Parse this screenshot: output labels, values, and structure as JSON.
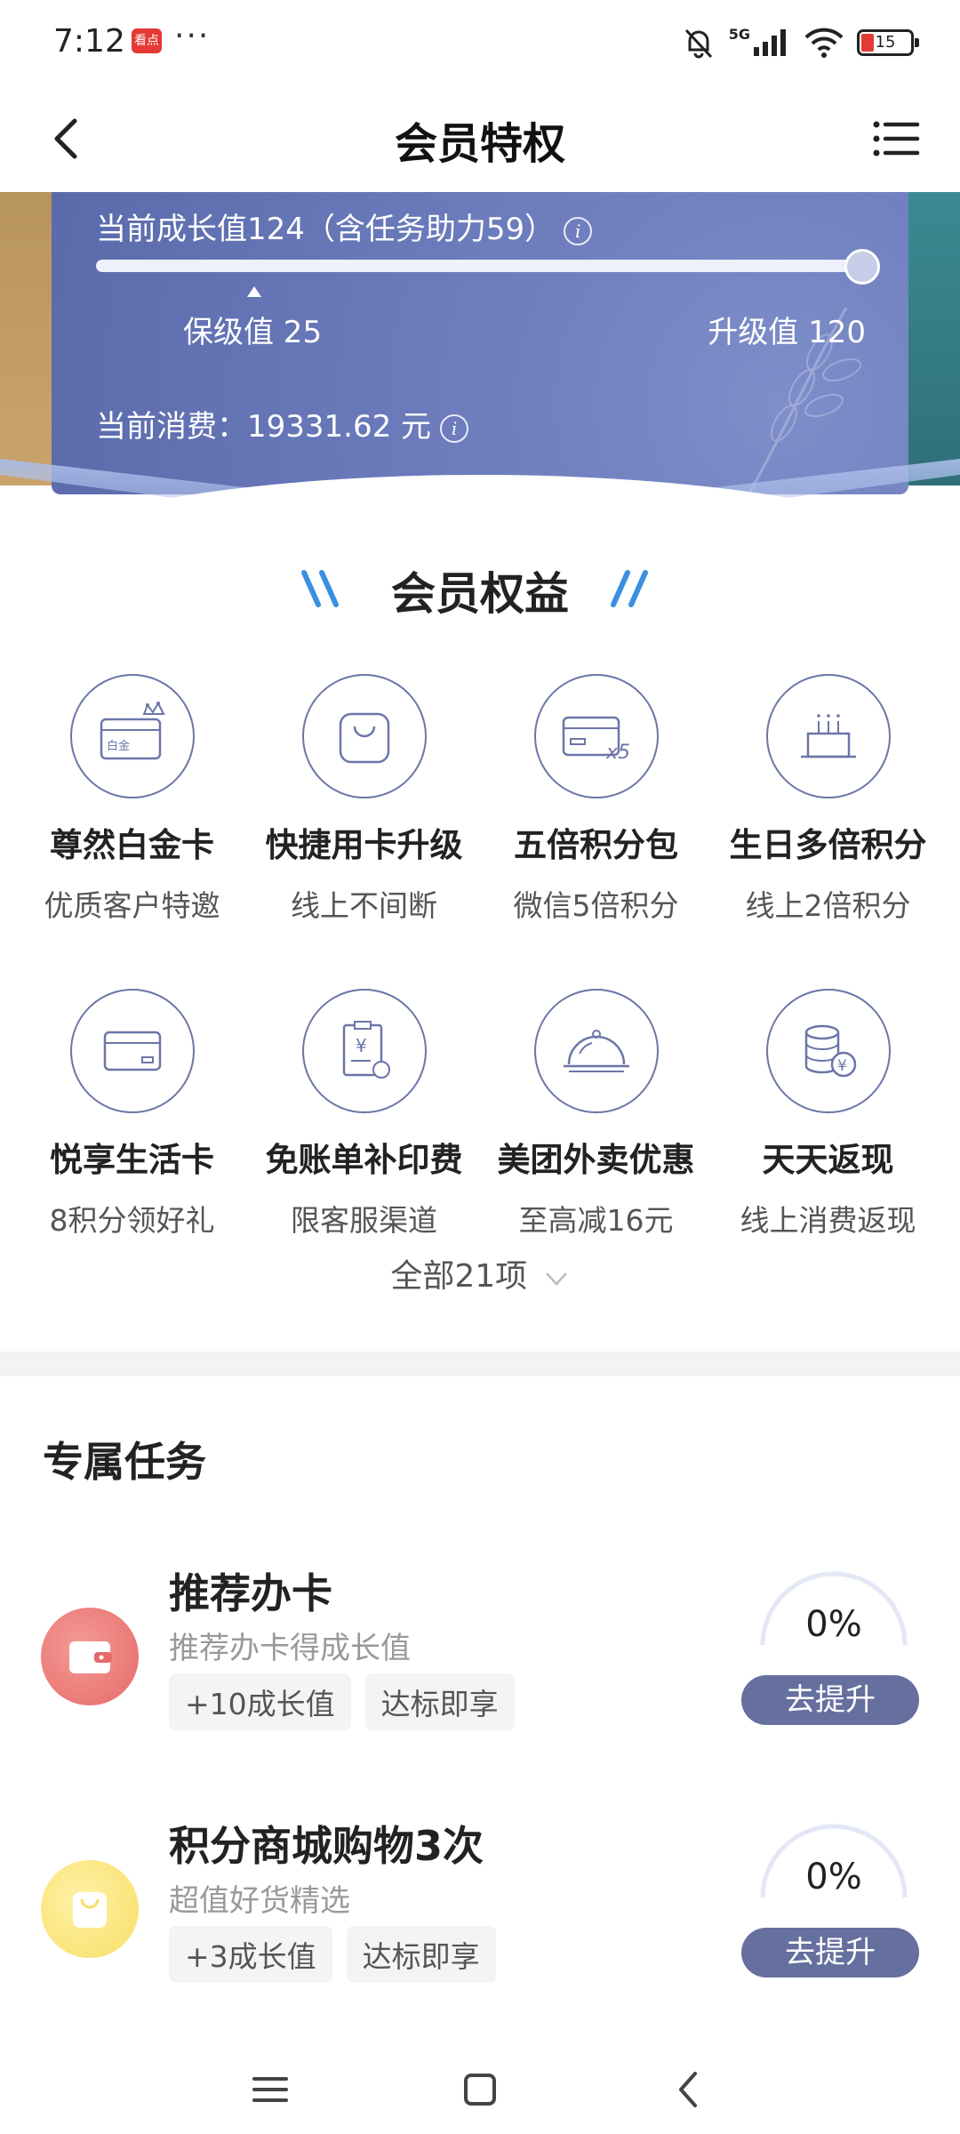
{
  "status_bar": {
    "time": "7:12",
    "app_badge": "看点",
    "more": "···",
    "network": "5G",
    "battery": "15"
  },
  "nav": {
    "title": "会员特权",
    "back_icon": "chevron-left-icon",
    "menu_icon": "list-menu-icon"
  },
  "growth": {
    "current": "当前成长值124（含任务助力59）",
    "progress_fraction": 1.0,
    "keep_label": "保级值 25",
    "upgrade_label": "升级值 120",
    "spend": "当前消费：19331.62 元",
    "info_glyph": "i",
    "card_color": "#6d7dbd"
  },
  "benefits": {
    "title": "会员权益",
    "items": [
      {
        "title": "尊然白金卡",
        "sub": "优质客户特邀",
        "icon": "platinum-card-icon",
        "card_text": "白金"
      },
      {
        "title": "快捷用卡升级",
        "sub": "线上不间断",
        "icon": "shopping-bag-icon"
      },
      {
        "title": "五倍积分包",
        "sub": "微信5倍积分",
        "icon": "card-x5-icon",
        "badge": "x5"
      },
      {
        "title": "生日多倍积分",
        "sub": "线上2倍积分",
        "icon": "birthday-cake-icon"
      },
      {
        "title": "悦享生活卡",
        "sub": "8积分领好礼",
        "icon": "life-card-icon"
      },
      {
        "title": "免账单补印费",
        "sub": "限客服渠道",
        "icon": "bill-receipt-icon",
        "symbol": "¥"
      },
      {
        "title": "美团外卖优惠",
        "sub": "至高减16元",
        "icon": "food-cloche-icon"
      },
      {
        "title": "天天返现",
        "sub": "线上消费返现",
        "icon": "coin-stack-icon",
        "symbol": "¥"
      }
    ],
    "all_label": "全部21项"
  },
  "tasks": {
    "title": "专属任务",
    "items": [
      {
        "title": "推荐办卡",
        "sub": "推荐办卡得成长值",
        "tags": [
          "+10成长值",
          "达标即享"
        ],
        "percent": "0%",
        "button": "去提升",
        "icon": "wallet-icon",
        "color": "#e56a6a"
      },
      {
        "title": "积分商城购物3次",
        "sub": "超值好货精选",
        "tags": [
          "+3成长值",
          "达标即享"
        ],
        "percent": "0%",
        "button": "去提升",
        "icon": "shopping-bag-icon",
        "color": "#f8dd66"
      }
    ]
  },
  "colors": {
    "accent": "#66709f",
    "icon_stroke": "#6b76a8",
    "deco_blue": "#3a8fe0"
  }
}
